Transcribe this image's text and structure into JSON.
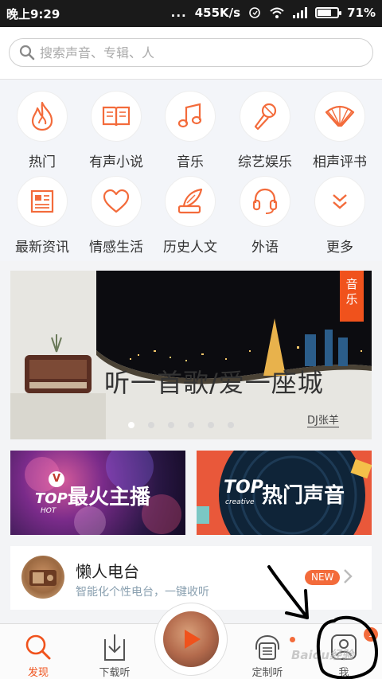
{
  "status_bar": {
    "time": "晚上9:29",
    "dots": "...",
    "speed": "455K/s",
    "battery": "71%",
    "battery_level": 0.71
  },
  "search": {
    "placeholder": "搜索声音、专辑、人"
  },
  "categories": [
    {
      "label": "热门",
      "icon": "flame-icon"
    },
    {
      "label": "有声小说",
      "icon": "book-icon"
    },
    {
      "label": "音乐",
      "icon": "music-note-icon"
    },
    {
      "label": "综艺娱乐",
      "icon": "microphone-icon"
    },
    {
      "label": "相声评书",
      "icon": "folding-fan-icon"
    },
    {
      "label": "最新资讯",
      "icon": "newspaper-icon"
    },
    {
      "label": "情感生活",
      "icon": "heart-icon"
    },
    {
      "label": "历史人文",
      "icon": "quill-book-icon"
    },
    {
      "label": "外语",
      "icon": "headset-icon"
    },
    {
      "label": "更多",
      "icon": "double-chevron-down-icon"
    }
  ],
  "banner": {
    "tag": "音乐",
    "slogan": "听一首歌/爱一座城",
    "credit": "DJ张羊",
    "slides": 6,
    "active_slide": 1
  },
  "promos": [
    {
      "logo": "TOP",
      "sub": "HOT",
      "badge": "V",
      "title": "最火主播"
    },
    {
      "logo": "TOP",
      "sub": "creative",
      "title": "热门声音"
    }
  ],
  "radio": {
    "title": "懒人电台",
    "subtitle": "智能化个性电台，一键收听",
    "badge": "NEW"
  },
  "bottom_nav": [
    {
      "label": "发现",
      "icon": "search-icon",
      "active": true
    },
    {
      "label": "下载听",
      "icon": "download-icon",
      "active": false
    },
    {
      "label": "定制听",
      "icon": "custom-radio-icon",
      "active": false
    },
    {
      "label": "我",
      "icon": "user-icon",
      "active": false,
      "badge": "1"
    }
  ],
  "watermark": "Baidu经验",
  "colors": {
    "accent": "#f0521c",
    "icon_orange": "#f36b3b"
  }
}
